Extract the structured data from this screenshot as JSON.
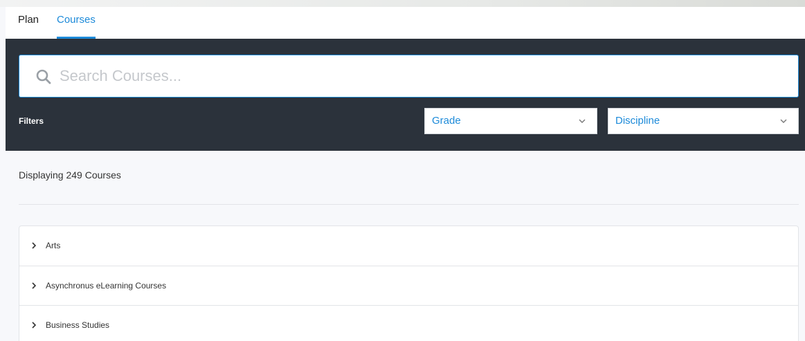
{
  "tabs": {
    "plan": "Plan",
    "courses": "Courses"
  },
  "search": {
    "placeholder": "Search Courses..."
  },
  "filters": {
    "label": "Filters",
    "grade": "Grade",
    "discipline": "Discipline"
  },
  "results": {
    "count_text": "Displaying 249 Courses"
  },
  "categories": [
    {
      "label": "Arts"
    },
    {
      "label": "Asynchronus eLearning Courses"
    },
    {
      "label": "Business Studies"
    }
  ],
  "icons": {
    "search": "search-icon",
    "dropdown": "chevron-down-icon",
    "expand": "chevron-right-icon"
  },
  "colors": {
    "accent": "#1c8ad9",
    "panel": "#2b323b",
    "background": "#f7f8fb"
  }
}
